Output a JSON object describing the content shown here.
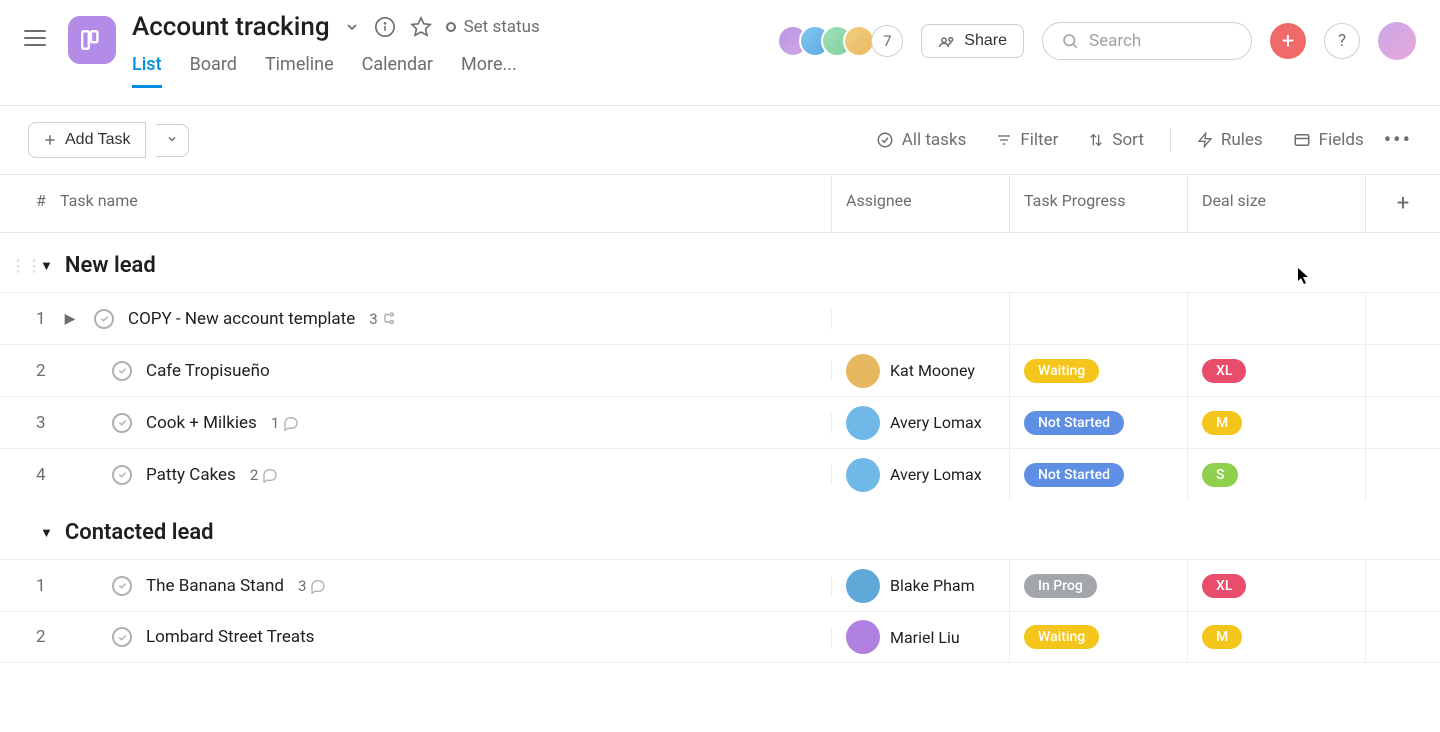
{
  "header": {
    "title": "Account tracking",
    "set_status": "Set status",
    "share": "Share",
    "search_placeholder": "Search",
    "avatar_overflow": "7",
    "avatars": [
      {
        "bg": "linear-gradient(135deg,#b695e0,#d5a8e9)"
      },
      {
        "bg": "linear-gradient(135deg,#7fc8f0,#5fa8e0)"
      },
      {
        "bg": "linear-gradient(135deg,#9fe0b8,#7fd0a0)"
      },
      {
        "bg": "linear-gradient(135deg,#f0d080,#e8b860)"
      }
    ]
  },
  "tabs": [
    "List",
    "Board",
    "Timeline",
    "Calendar",
    "More..."
  ],
  "active_tab": 0,
  "toolbar": {
    "add_task": "Add Task",
    "all_tasks": "All tasks",
    "filter": "Filter",
    "sort": "Sort",
    "rules": "Rules",
    "fields": "Fields"
  },
  "columns": {
    "num": "#",
    "task_name": "Task name",
    "assignee": "Assignee",
    "progress": "Task Progress",
    "deal_size": "Deal size"
  },
  "progress_colors": {
    "Waiting": "#f4c51a",
    "Not Started": "#5f8fe4",
    "In Prog": "#a3a7ab"
  },
  "deal_colors": {
    "XL": "#e84d6b",
    "M": "#f4c51a",
    "S": "#8fd14f"
  },
  "avatar_colors": {
    "Kat Mooney": "#e8b860",
    "Avery Lomax": "#6fb8e8",
    "Blake Pham": "#5fa8d8",
    "Mariel Liu": "#b080e0"
  },
  "sections": [
    {
      "title": "New lead",
      "show_drag": true,
      "rows": [
        {
          "num": "1",
          "name": "COPY - New account template",
          "expandable": true,
          "subtasks": "3",
          "sub_icon": "branch",
          "assignee": null,
          "progress": null,
          "deal": null,
          "indent": false
        },
        {
          "num": "2",
          "name": "Cafe Tropisueño",
          "assignee": "Kat Mooney",
          "progress": "Waiting",
          "deal": "XL",
          "indent": true
        },
        {
          "num": "3",
          "name": "Cook + Milkies",
          "comments": "1",
          "assignee": "Avery Lomax",
          "progress": "Not Started",
          "deal": "M",
          "indent": true
        },
        {
          "num": "4",
          "name": "Patty Cakes",
          "comments": "2",
          "assignee": "Avery Lomax",
          "progress": "Not Started",
          "deal": "S",
          "indent": true
        }
      ]
    },
    {
      "title": "Contacted lead",
      "show_drag": false,
      "rows": [
        {
          "num": "1",
          "name": "The Banana Stand",
          "comments": "3",
          "assignee": "Blake Pham",
          "progress": "In Prog",
          "deal": "XL",
          "indent": true
        },
        {
          "num": "2",
          "name": "Lombard Street Treats",
          "assignee": "Mariel Liu",
          "progress": "Waiting",
          "deal": "M",
          "indent": true
        }
      ]
    }
  ]
}
